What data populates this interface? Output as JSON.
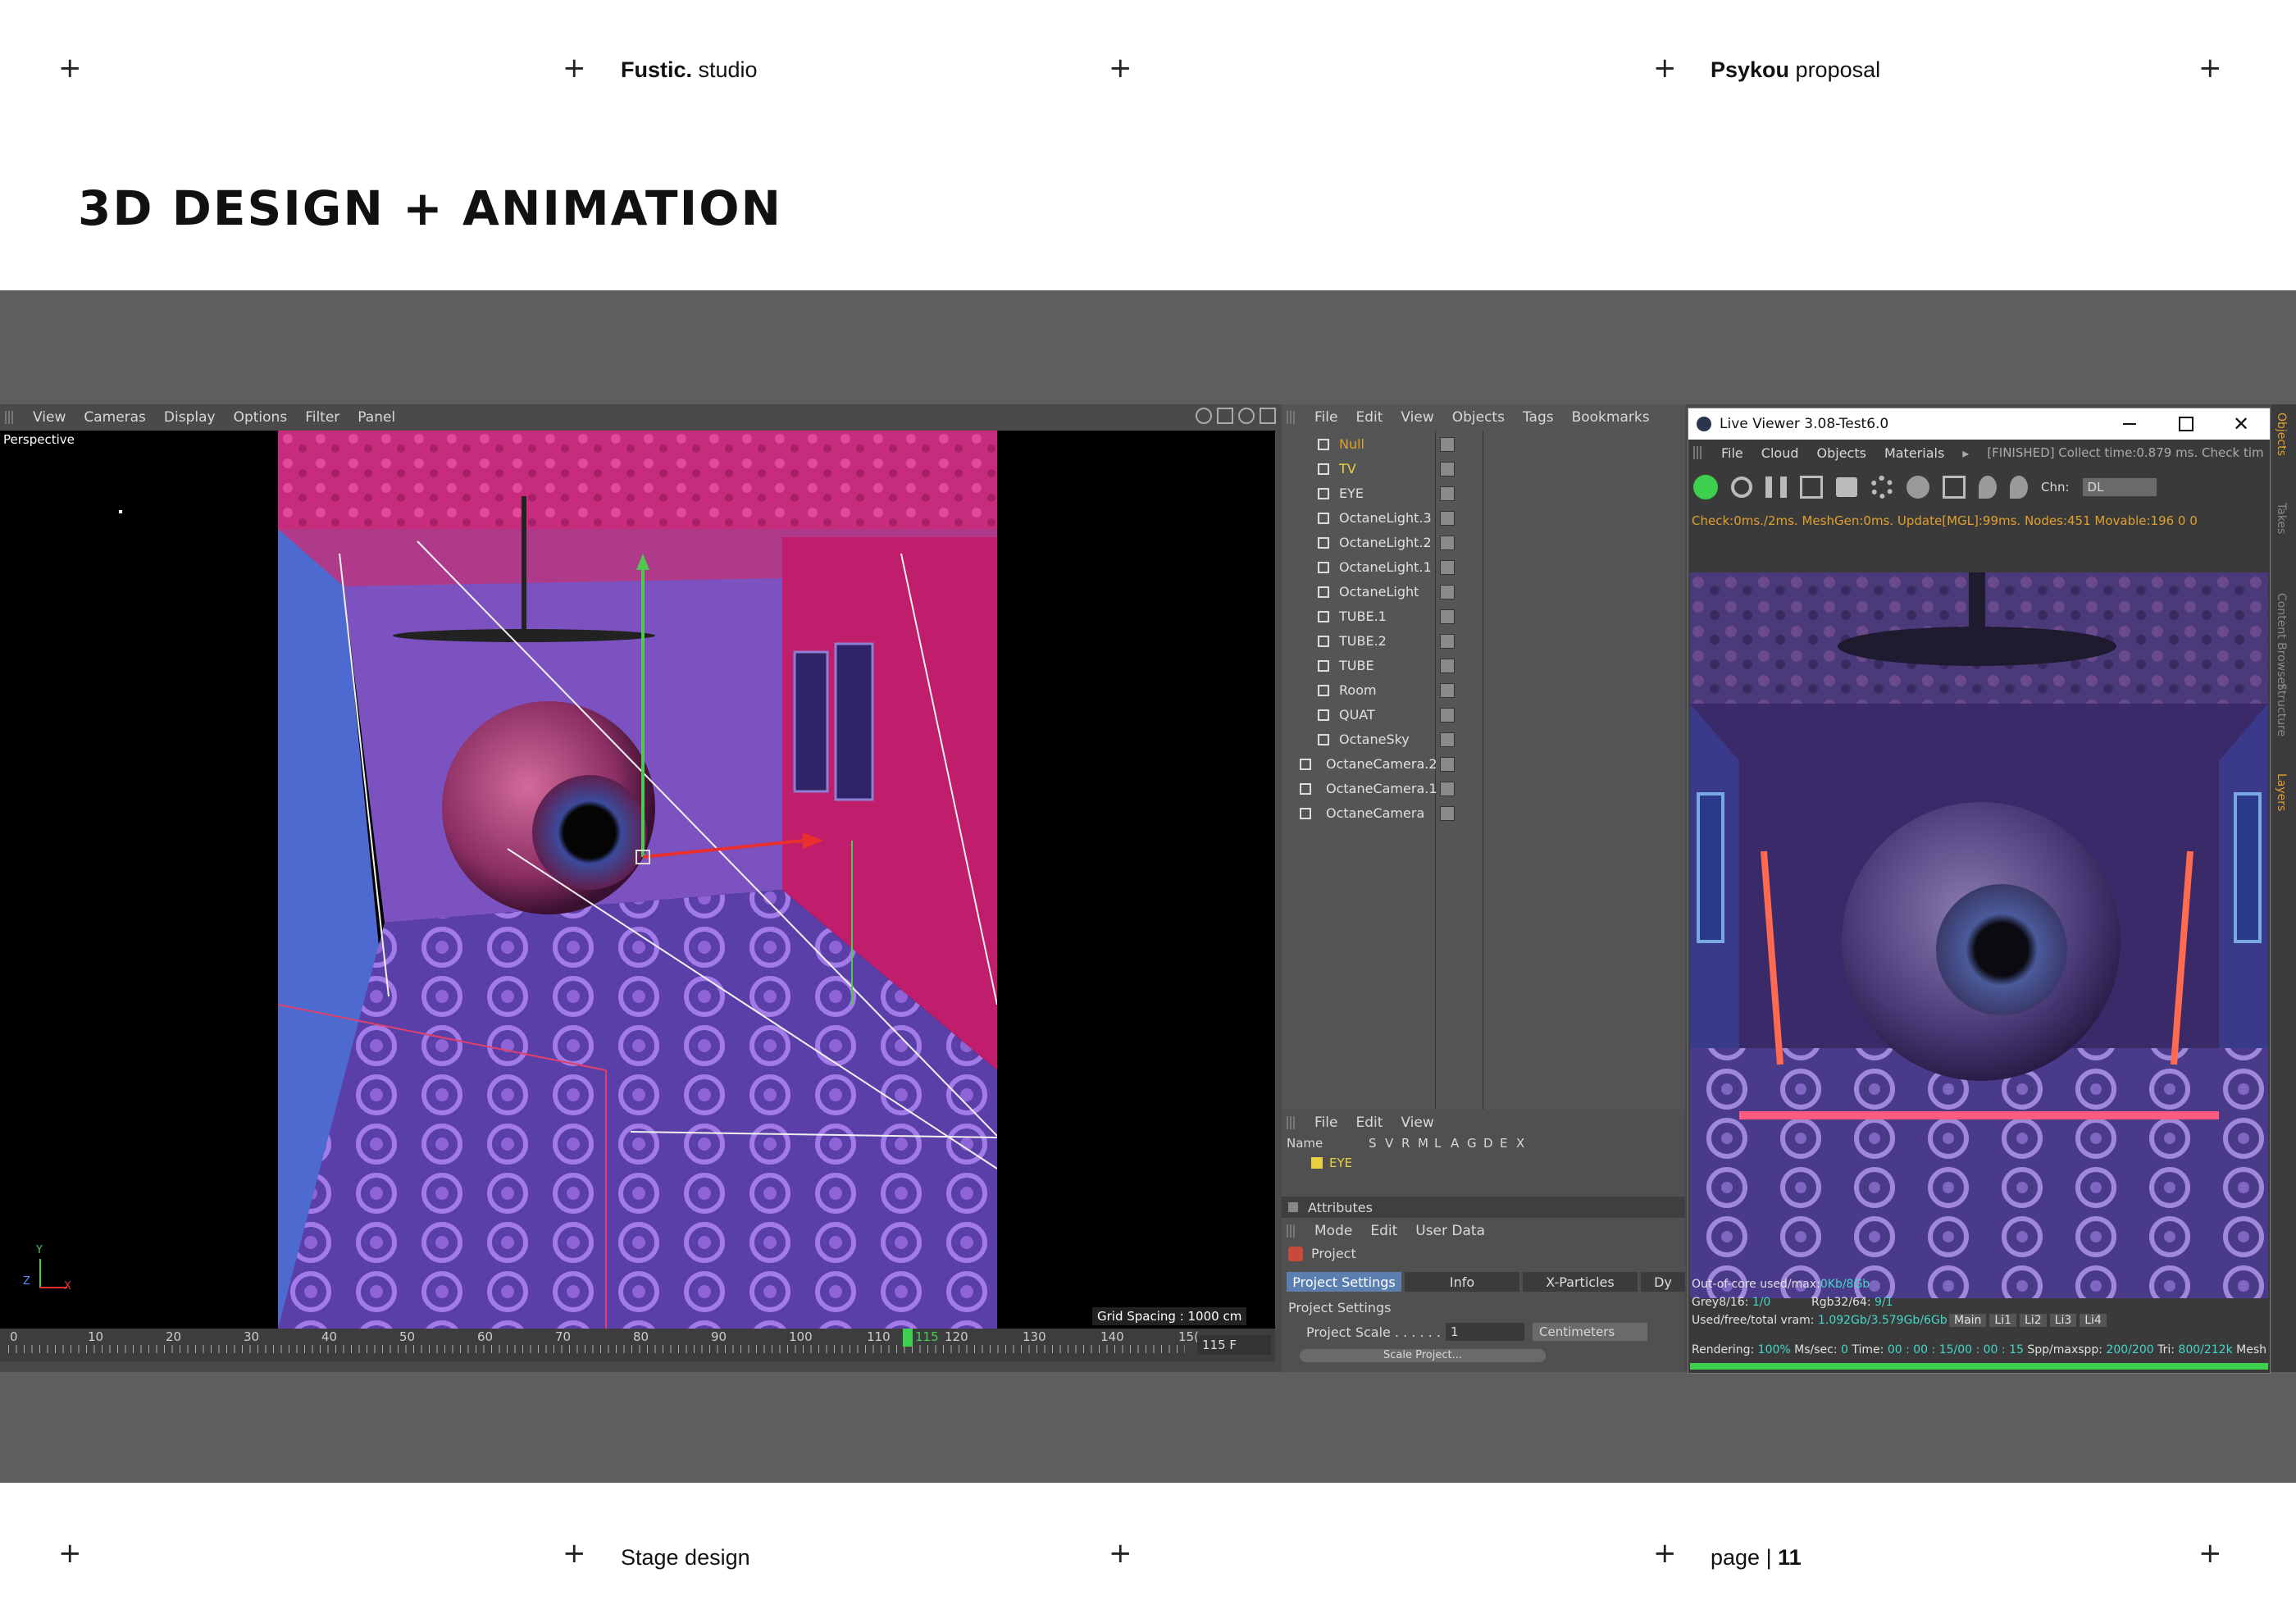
{
  "header": {
    "studio_bold": "Fustic.",
    "studio_rest": " studio",
    "proposal_bold": "Psykou",
    "proposal_rest": " proposal",
    "plus": "+"
  },
  "title": "3D DESIGN + ANIMATION",
  "footer": {
    "section": "Stage design",
    "page_label": "page | ",
    "page_number": "11"
  },
  "viewport": {
    "menu": [
      "View",
      "Cameras",
      "Display",
      "Options",
      "Filter",
      "Panel"
    ],
    "mode_label": "Perspective",
    "grid_spacing": "Grid Spacing : 1000 cm",
    "axis_y": "Y",
    "axis_z": "Z",
    "axis_x": "X"
  },
  "timeline": {
    "ticks": [
      "0",
      "10",
      "20",
      "30",
      "40",
      "50",
      "60",
      "70",
      "80",
      "90",
      "100",
      "110",
      "120",
      "130",
      "140",
      "15("
    ],
    "current": "115",
    "frame_field": "115 F"
  },
  "object_manager": {
    "menu": [
      "File",
      "Edit",
      "View",
      "Objects",
      "Tags",
      "Bookmarks"
    ],
    "objects": [
      {
        "name": "Null",
        "color": "#e0a030"
      },
      {
        "name": "TV",
        "color": "#e8d040"
      },
      {
        "name": "EYE",
        "color": "#e0e0e0"
      },
      {
        "name": "OctaneLight.3",
        "color": "#e0e0e0"
      },
      {
        "name": "OctaneLight.2",
        "color": "#e0e0e0"
      },
      {
        "name": "OctaneLight.1",
        "color": "#e0e0e0"
      },
      {
        "name": "OctaneLight",
        "color": "#e0e0e0"
      },
      {
        "name": "TUBE.1",
        "color": "#e0e0e0"
      },
      {
        "name": "TUBE.2",
        "color": "#e0e0e0"
      },
      {
        "name": "TUBE",
        "color": "#e0e0e0"
      },
      {
        "name": "Room",
        "color": "#e0e0e0"
      },
      {
        "name": "QUAT",
        "color": "#e0e0e0"
      },
      {
        "name": "OctaneSky",
        "color": "#e0e0e0"
      },
      {
        "name": "OctaneCamera.2",
        "color": "#e0e0e0"
      },
      {
        "name": "OctaneCamera.1",
        "color": "#e0e0e0"
      },
      {
        "name": "OctaneCamera",
        "color": "#e0e0e0"
      }
    ]
  },
  "layers": {
    "menu": [
      "File",
      "Edit",
      "View"
    ],
    "columns": [
      "Name",
      "S",
      "V",
      "R",
      "M",
      "L",
      "A",
      "G",
      "D",
      "E",
      "X"
    ],
    "row_name": "EYE"
  },
  "attributes": {
    "title": "Attributes",
    "menu": [
      "Mode",
      "Edit",
      "User Data"
    ],
    "object": "Project",
    "tabs": [
      "Project Settings",
      "Info",
      "X-Particles",
      "Dy"
    ],
    "section": "Project Settings",
    "scale_label": "Project Scale . . . . . .",
    "scale_value": "1",
    "scale_unit": "Centimeters",
    "scale_button": "Scale Project..."
  },
  "live_viewer": {
    "title": "Live Viewer 3.08-Test6.0",
    "menu": [
      "File",
      "Cloud",
      "Objects",
      "Materials"
    ],
    "status": "[FINISHED] Collect time:0.879 ms.  Check tim",
    "channel_label": "Chn:",
    "channel_value": "DL",
    "check_line": "Check:0ms./2ms. MeshGen:0ms. Update[MGL]:99ms. Nodes:451 Movable:196  0 0",
    "stats": {
      "ooc_label": "Out-of-core used/max:",
      "ooc_value": "0Kb/8Gb",
      "grey_label": "Grey8/16: ",
      "grey_value": "1/0",
      "rgb_label": "Rgb32/64: ",
      "rgb_value": "9/1",
      "vram_label": "Used/free/total vram: ",
      "vram_value": "1.092Gb/3.579Gb/6Gb",
      "render_label": "Rendering: ",
      "render_value": "100%",
      "ms_label": " Ms/sec: ",
      "ms_value": "0",
      "time_label": "   Time: ",
      "time_value": "00 : 00 : 15/00 : 00 : 15",
      "spp_label": "  Spp/maxspp: ",
      "spp_value": "200/200",
      "tri_label": "   Tri: ",
      "tri_value": "800/212k",
      "mesh_label": "   Mesh:"
    },
    "tabs": [
      "Main",
      "Li1",
      "Li2",
      "Li3",
      "Li4"
    ],
    "progress": 1.0
  },
  "side_tabs": [
    "Objects",
    "Takes",
    "Content Browser",
    "Structure",
    "Layers"
  ],
  "colors": {
    "band": "#5e5e5e",
    "panel": "#4a4a4a",
    "accent_green": "#3fcf4f",
    "accent_teal": "#44d6c8"
  }
}
